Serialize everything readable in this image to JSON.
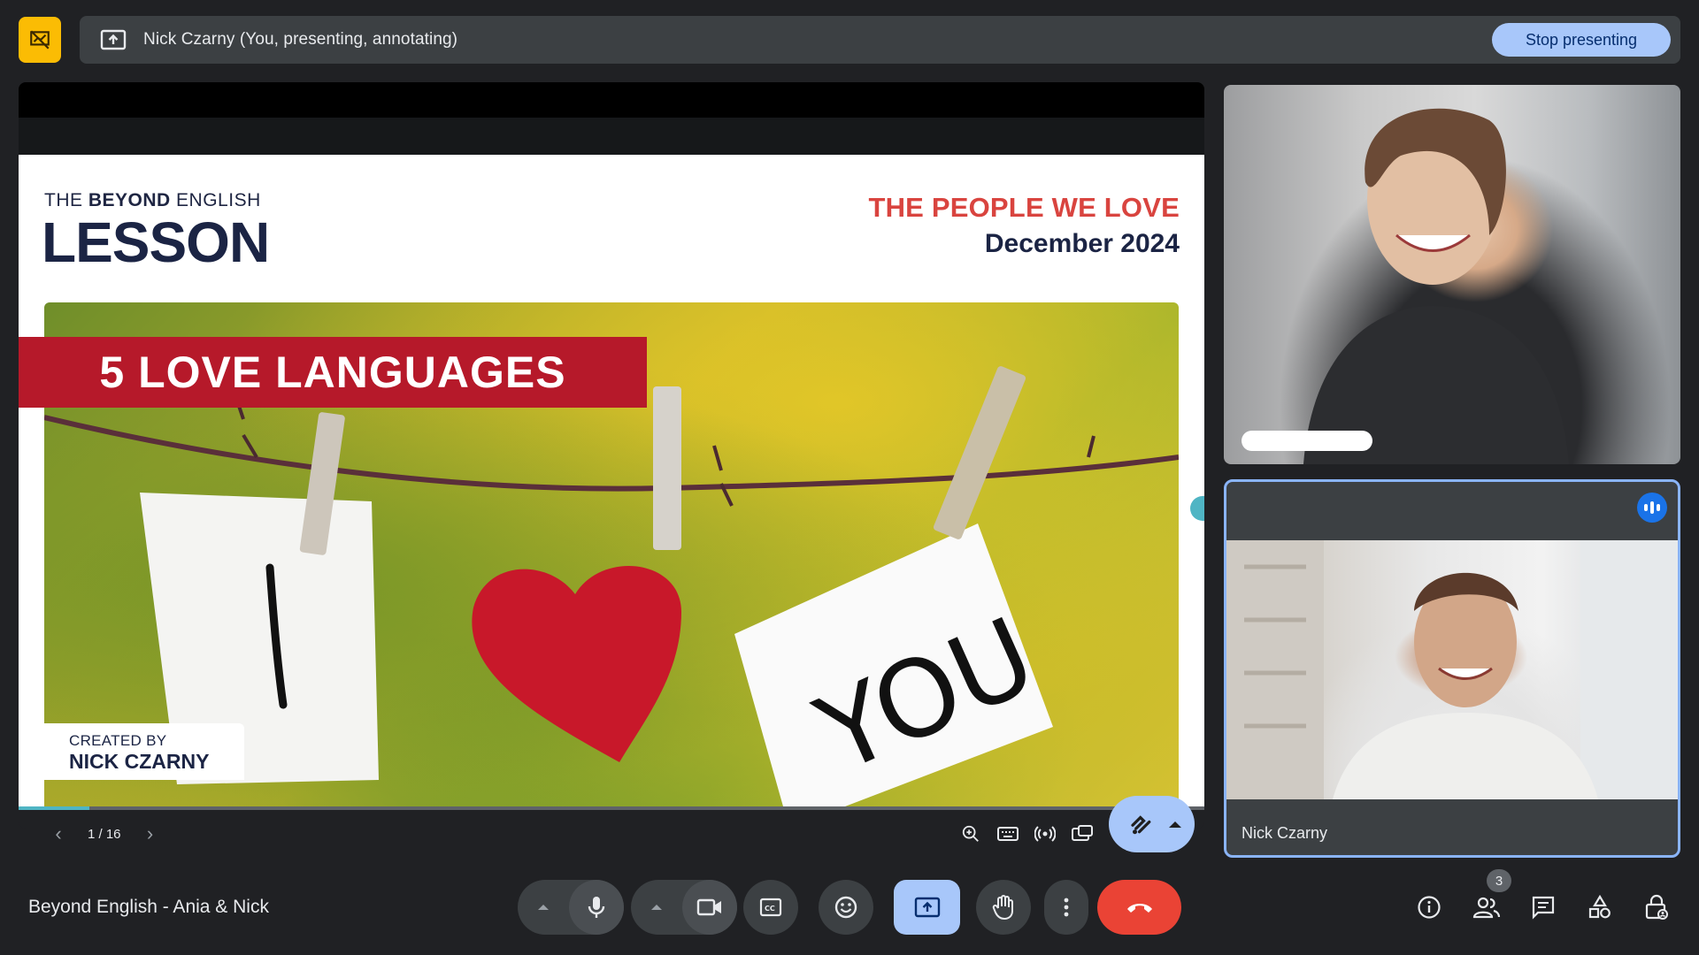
{
  "top_bar": {
    "presenter_text": "Nick Czarny (You, presenting, annotating)",
    "stop_label": "Stop presenting"
  },
  "slide": {
    "brand_prefix": "THE",
    "brand_bold": "BEYOND",
    "brand_suffix": "ENGLISH",
    "brand_lesson": "LESSON",
    "headline": "THE PEOPLE WE LOVE",
    "date": "December 2024",
    "banner": "5 LOVE LANGUAGES",
    "created_by_label": "CREATED BY",
    "created_by_name": "NICK CZARNY",
    "progress_fraction": 0.06
  },
  "slide_nav": {
    "page": "1 / 16"
  },
  "participants": {
    "main_tile_name": "Nick Czarny",
    "people_count": "3"
  },
  "footer": {
    "meeting_title": "Beyond English - Ania & Nick"
  },
  "colors": {
    "accent": "#a8c7fa",
    "presenting_yellow": "#fbbc04",
    "end_call_red": "#ea4335",
    "banner_red": "#b6192a",
    "speaking_blue": "#1a73e8"
  }
}
